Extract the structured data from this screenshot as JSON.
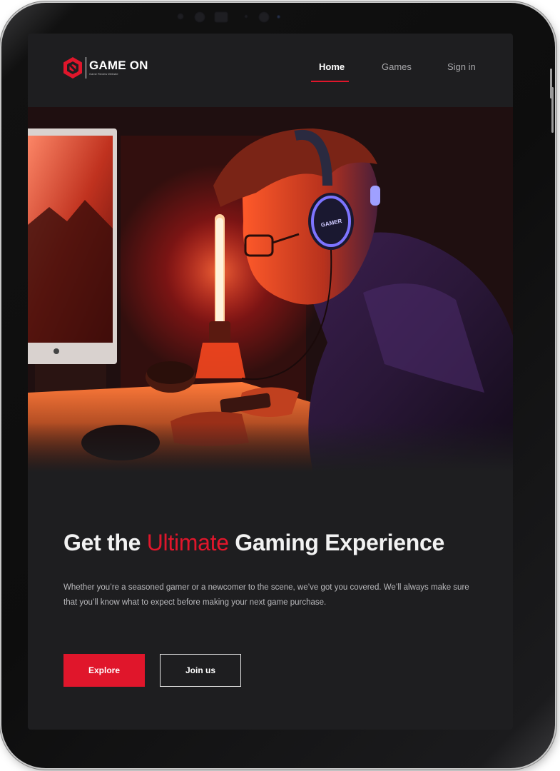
{
  "brand": {
    "title": "GAME ON",
    "subtitle": "Game Review Website",
    "accent_color": "#e0162b"
  },
  "nav": {
    "items": [
      {
        "label": "Home",
        "active": true
      },
      {
        "label": "Games",
        "active": false
      },
      {
        "label": "Sign in",
        "active": false
      }
    ]
  },
  "hero": {
    "image": "gamer-with-headphones-illustration",
    "headphone_text": "GAMER"
  },
  "content": {
    "headline_before": "Get the ",
    "headline_accent": "Ultimate",
    "headline_after": " Gaming Experience",
    "description": "Whether you’re a seasoned gamer or a newcomer to the scene, we’ve got you covered. We’ll always make sure that you’ll know what to expect before making your next game purchase."
  },
  "buttons": {
    "explore_label": "Explore",
    "join_label": "Join us"
  },
  "colors": {
    "background": "#1e1e20",
    "text": "#f2f2f2",
    "muted": "#b9b9bc"
  }
}
